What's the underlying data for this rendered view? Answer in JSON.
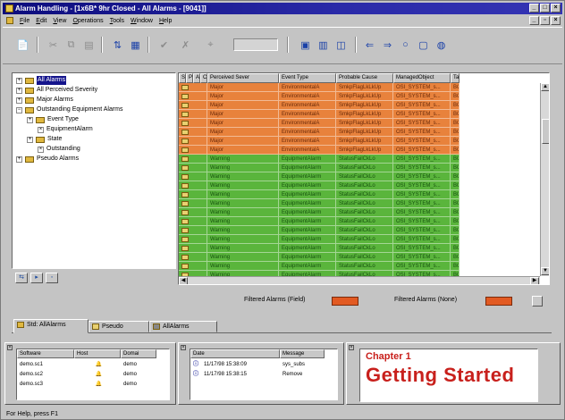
{
  "window": {
    "title": "Alarm Handling - [1x6B* 9hr Closed - All Alarms - [9041]]"
  },
  "menu": {
    "items": [
      "File",
      "Edit",
      "View",
      "Operations",
      "Tools",
      "Window",
      "Help"
    ]
  },
  "tree": {
    "items": [
      {
        "label": "All Alarms",
        "level": 0,
        "selected": true
      },
      {
        "label": "All Perceived Severity",
        "level": 0
      },
      {
        "label": "Major Alarms",
        "level": 0
      },
      {
        "label": "Outstanding Equipment Alarms",
        "level": 0
      },
      {
        "label": "Event Type",
        "level": 1
      },
      {
        "label": "EquipmentAlarm",
        "level": 2
      },
      {
        "label": "State",
        "level": 1
      },
      {
        "label": "Outstanding",
        "level": 2
      },
      {
        "label": "Pseudo Alarms",
        "level": 0
      }
    ]
  },
  "grid": {
    "columns": [
      "S",
      "P",
      "A",
      "C",
      "Perceived Sever",
      "Event Type",
      "Probable Cause",
      "ManagedObject",
      "Tau"
    ],
    "major_rows": 8,
    "warning_rows": 14,
    "major": {
      "severity": "Major",
      "event": "EnvironmentalA",
      "cause": "SmkpFlagLkLkUp",
      "object": "OSI_SYSTEM_s...",
      "tail": "BC"
    },
    "warning": {
      "severity": "Warning",
      "event": "EquipmentAlarm",
      "cause": "StatusFailCkLo",
      "object": "OSI_SYSTEM_s...",
      "tail": "BC"
    },
    "colors": {
      "major": "#e8823c",
      "warning": "#5ab53c"
    }
  },
  "legend": {
    "filtered_field": "Filtered Alarms (Field)",
    "filtered_none": "Filtered Alarms (None)"
  },
  "tabs": [
    "Std: AllAlarms",
    "Pseudo",
    "AllAlarms"
  ],
  "software_pane": {
    "columns": [
      "Software",
      "Host",
      "Domai"
    ],
    "rows": [
      {
        "sw": "demo.sc1",
        "host": "",
        "dom": "demo"
      },
      {
        "sw": "demo.sc2",
        "host": "",
        "dom": "demo"
      },
      {
        "sw": "demo.sc3",
        "host": "",
        "dom": "demo"
      }
    ]
  },
  "date_pane": {
    "columns": [
      "Date",
      "Message"
    ],
    "rows": [
      {
        "date": "11/17/98 15:38:09",
        "msg": "sys_subs"
      },
      {
        "date": "11/17/98 15:38:15",
        "msg": "Remove"
      }
    ]
  },
  "chapter": {
    "number": "Chapter 1",
    "title": "Getting Started"
  },
  "status": {
    "text": "For Help, press F1"
  }
}
